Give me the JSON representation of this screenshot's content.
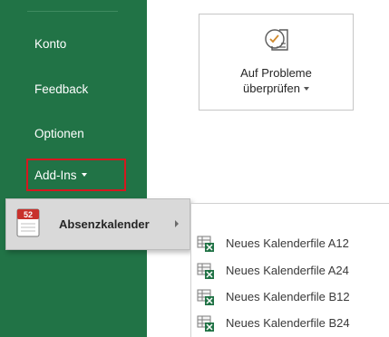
{
  "sidebar": {
    "items": [
      {
        "label": "Konto"
      },
      {
        "label": "Feedback"
      },
      {
        "label": "Optionen"
      },
      {
        "label": "Add-Ins"
      }
    ],
    "background": "#217346",
    "highlight_color": "#d6171f"
  },
  "check_card": {
    "icon": "document-check-icon",
    "label_line1": "Auf Probleme",
    "label_line2": "überprüfen"
  },
  "flyout": {
    "icon": "calendar-52-icon",
    "icon_text": "52",
    "label": "Absenzkalender"
  },
  "submenu": {
    "items": [
      {
        "label": "Neues Kalenderfile A12",
        "icon": "excel-table-icon"
      },
      {
        "label": "Neues Kalenderfile A24",
        "icon": "excel-table-icon"
      },
      {
        "label": "Neues Kalenderfile B12",
        "icon": "excel-table-icon"
      },
      {
        "label": "Neues Kalenderfile B24",
        "icon": "excel-table-icon"
      }
    ]
  }
}
